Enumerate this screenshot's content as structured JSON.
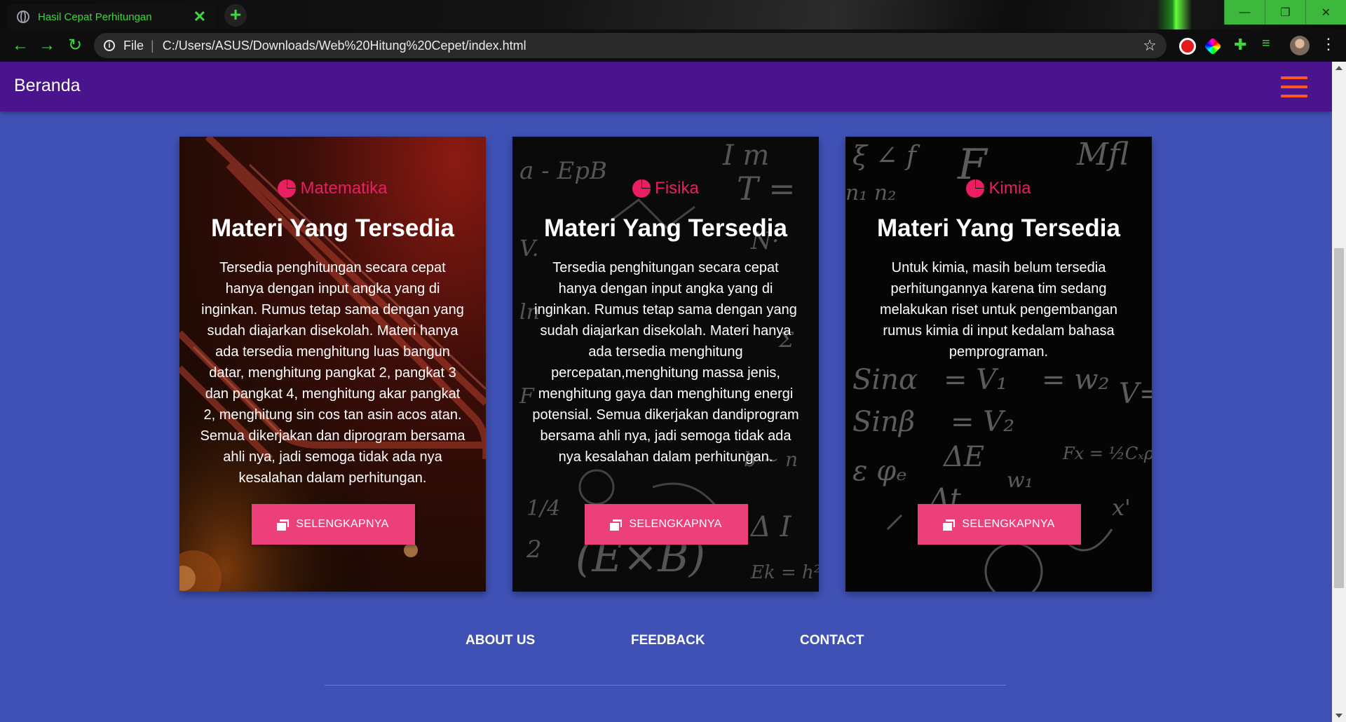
{
  "browser": {
    "tab_title": "Hasil Cepat Perhitungan",
    "tab_close": "✕",
    "new_tab": "+",
    "url_scheme": "File",
    "url": "C:/Users/ASUS/Downloads/Web%20Hitung%20Cepet/index.html",
    "window_buttons": [
      "—",
      "❐",
      "✕"
    ]
  },
  "navbar": {
    "brand": "Beranda"
  },
  "cards": [
    {
      "subject": "Matematika",
      "heading": "Materi Yang Tersedia",
      "body": "Tersedia penghitungan secara cepat hanya dengan input angka yang di inginkan. Rumus tetap sama dengan yang sudah diajarkan disekolah. Materi hanya ada tersedia menghitung luas bangun datar, menghitung pangkat 2, pangkat 3 dan pangkat 4, menghitung akar pangkat 2, menghitung sin cos tan asin acos atan. Semua dikerjakan dan diprogram bersama ahli nya, jadi semoga tidak ada nya kesalahan dalam perhitungan.",
      "button": "SELENGKAPNYA"
    },
    {
      "subject": "Fisika",
      "heading": "Materi Yang Tersedia",
      "body": "Tersedia penghitungan secara cepat hanya dengan input angka yang di inginkan. Rumus tetap sama dengan yang sudah diajarkan disekolah. Materi hanya ada tersedia menghitung percepatan,menghitung massa jenis, menghitung gaya dan menghitung energi potensial. Semua dikerjakan dandiprogram bersama ahli nya, jadi semoga tidak ada nya kesalahan dalam perhitungan.",
      "button": "SELENGKAPNYA"
    },
    {
      "subject": "Kimia",
      "heading": "Materi Yang Tersedia",
      "body": "Untuk kimia, masih belum tersedia perhitungannya karena tim sedang melakukan riset untuk pengembangan rumus kimia di input kedalam bahasa pemprograman.",
      "button": "SELENGKAPNYA"
    }
  ],
  "footer": {
    "links": [
      "ABOUT US",
      "FEEDBACK",
      "CONTACT"
    ]
  },
  "colors": {
    "page_bg": "#3f51b5",
    "navbar_bg": "#4a148c",
    "accent": "#e91e63",
    "button_bg": "#ec407a",
    "hamburger": "#ff5722",
    "browser_accent": "#3cd83c"
  }
}
